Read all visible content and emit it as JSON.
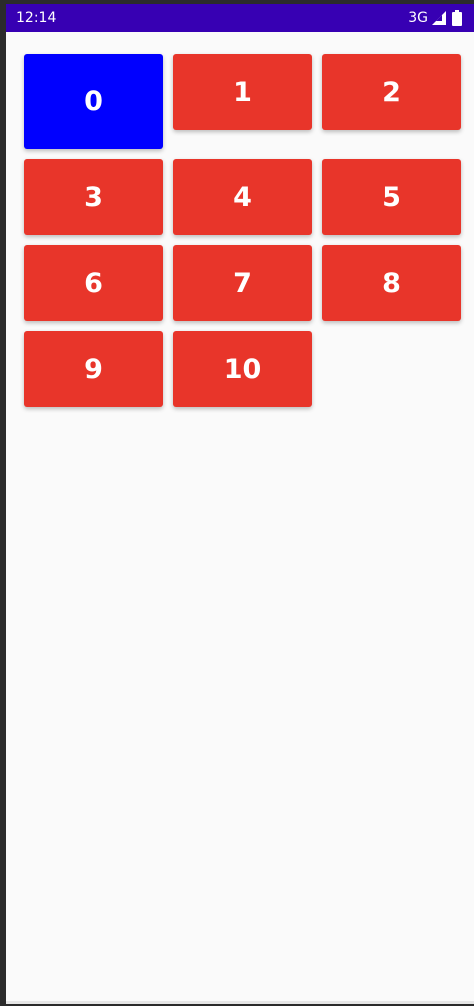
{
  "status_bar": {
    "time": "12:14",
    "network": "3G",
    "signal_icon": "signal-icon",
    "battery_icon": "battery-icon",
    "color": "#3700b3"
  },
  "tiles": [
    {
      "label": "0",
      "color": "#0000ff",
      "selected": true
    },
    {
      "label": "1",
      "color": "#e8352a"
    },
    {
      "label": "2",
      "color": "#e8352a"
    },
    {
      "label": "3",
      "color": "#e8352a"
    },
    {
      "label": "4",
      "color": "#e8352a"
    },
    {
      "label": "5",
      "color": "#e8352a"
    },
    {
      "label": "6",
      "color": "#e8352a"
    },
    {
      "label": "7",
      "color": "#e8352a"
    },
    {
      "label": "8",
      "color": "#e8352a"
    },
    {
      "label": "9",
      "color": "#e8352a"
    },
    {
      "label": "10",
      "color": "#e8352a"
    }
  ]
}
